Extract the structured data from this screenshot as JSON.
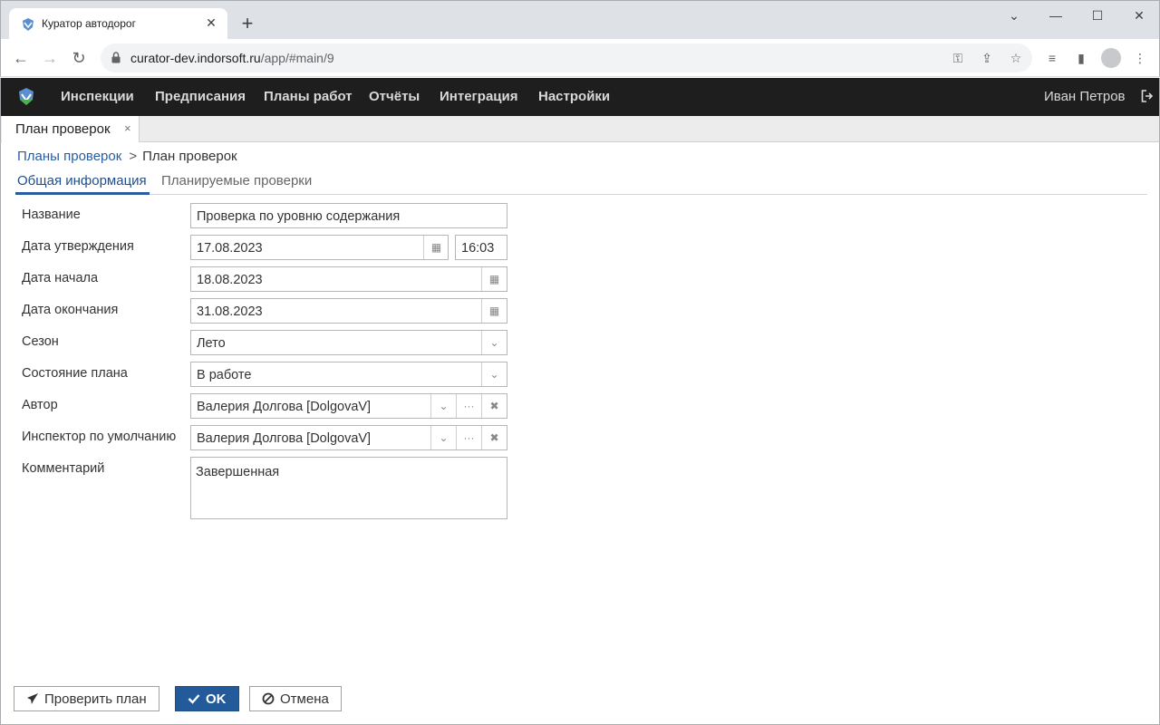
{
  "browser": {
    "tab_title": "Куратор автодорог",
    "tab_close": "✕",
    "new_tab": "+",
    "url_host": "curator-dev.indorsoft.ru",
    "url_path": "/app/#main/9"
  },
  "app": {
    "menu": [
      "Инспекции",
      "Предписания",
      "Планы работ",
      "Отчёты",
      "Интеграция",
      "Настройки"
    ],
    "user": "Иван Петров",
    "tab_label": "План проверок",
    "tab_close": "×"
  },
  "breadcrumb": {
    "link": "Планы проверок",
    "sep": ">",
    "current": "План проверок"
  },
  "subtabs": [
    "Общая информация",
    "Планируемые проверки"
  ],
  "form": {
    "name_label": "Название",
    "name_value": "Проверка по уровню содержания",
    "approval_label": "Дата утверждения",
    "approval_date": "17.08.2023",
    "approval_time": "16:03",
    "start_label": "Дата начала",
    "start_date": "18.08.2023",
    "end_label": "Дата окончания",
    "end_date": "31.08.2023",
    "season_label": "Сезон",
    "season_value": "Лето",
    "state_label": "Состояние плана",
    "state_value": "В работе",
    "author_label": "Автор",
    "author_value": "Валерия Долгова [DolgovaV]",
    "inspector_label": "Инспектор по умолчанию",
    "inspector_value": "Валерия Долгова [DolgovaV]",
    "comment_label": "Комментарий",
    "comment_value": "Завершенная"
  },
  "buttons": {
    "check": "Проверить план",
    "ok": "OK",
    "cancel": "Отмена"
  },
  "colors": {
    "accent": "#2a5d9f",
    "nav_bg": "#1e1e1e",
    "primary_button": "#235a99"
  }
}
